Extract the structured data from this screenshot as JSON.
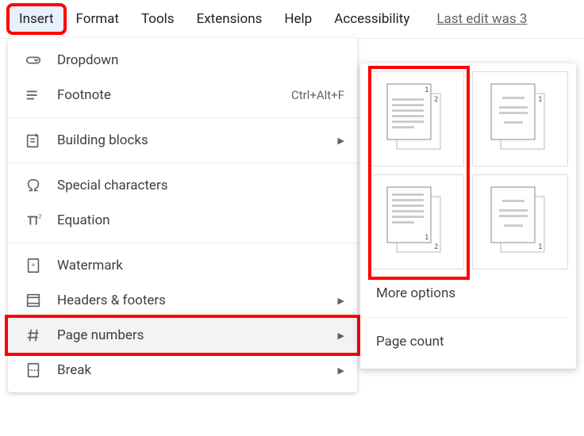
{
  "menubar": {
    "items": [
      "Insert",
      "Format",
      "Tools",
      "Extensions",
      "Help",
      "Accessibility"
    ],
    "last_edit": "Last edit was 3"
  },
  "menu": {
    "dropdown": "Dropdown",
    "footnote": "Footnote",
    "footnote_shortcut": "Ctrl+Alt+F",
    "building_blocks": "Building blocks",
    "special_chars": "Special characters",
    "equation": "Equation",
    "watermark": "Watermark",
    "headers_footers": "Headers & footers",
    "page_numbers": "Page numbers",
    "break": "Break"
  },
  "submenu": {
    "more_options": "More options",
    "page_count": "Page count"
  }
}
